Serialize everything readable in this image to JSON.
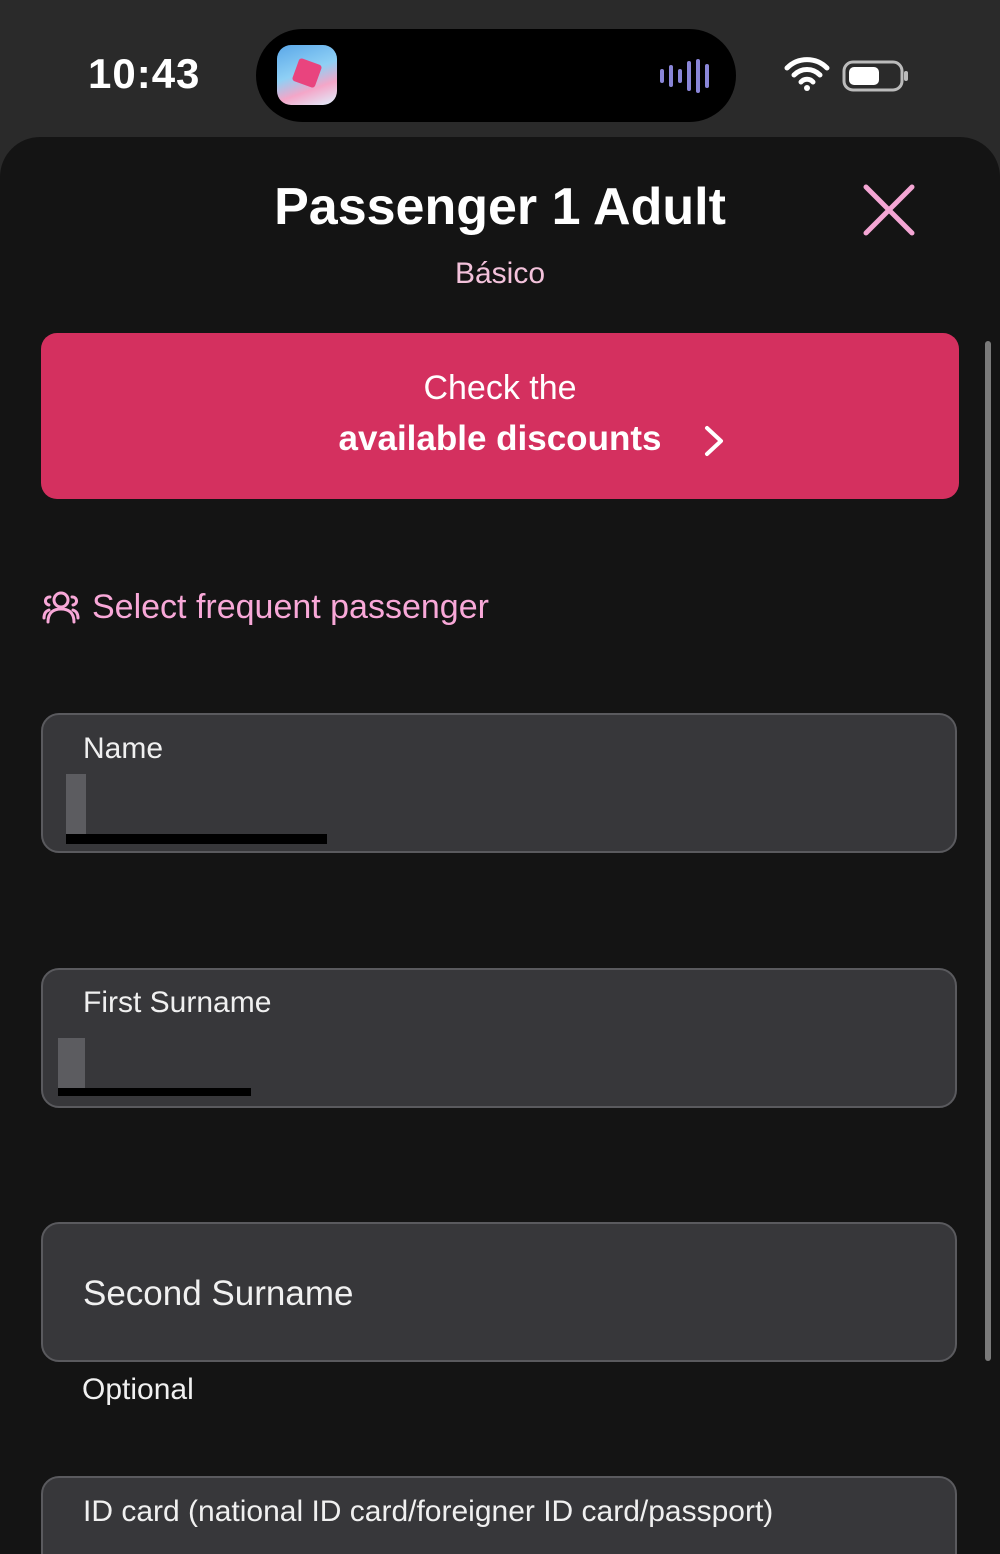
{
  "status_bar": {
    "time": "10:43",
    "icons": [
      "app-thumbnail",
      "waveform-icon",
      "wifi-icon",
      "battery-icon"
    ]
  },
  "header": {
    "title": "Passenger 1 Adult",
    "subtitle": "Básico",
    "close_icon": "close-icon"
  },
  "discount_banner": {
    "line1": "Check the",
    "line2": "available discounts",
    "icon": "chevron-right-icon"
  },
  "frequent_passenger": {
    "icon": "people-icon",
    "label": "Select frequent passenger"
  },
  "form": {
    "name": {
      "label": "Name",
      "value": ""
    },
    "first_surname": {
      "label": "First Surname",
      "value": ""
    },
    "second_surname": {
      "label": "Second Surname",
      "value": "",
      "helper": "Optional"
    },
    "id_card": {
      "label": "ID card (national ID card/foreigner ID card/passport)",
      "value": ""
    }
  },
  "colors": {
    "accent": "#d4305f",
    "accent_text": "#f8a8d8",
    "background": "#141414",
    "field_bg": "#37373a"
  }
}
